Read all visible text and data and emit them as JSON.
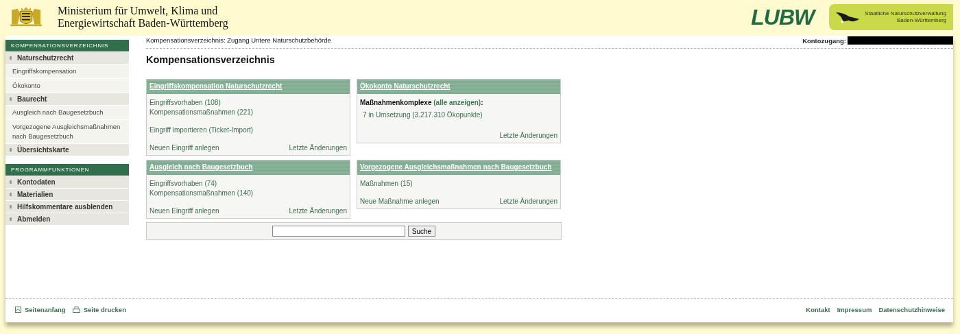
{
  "header": {
    "ministry_lines": [
      "Ministerium für Umwelt, Klima und",
      "Energiewirtschaft Baden-Württemberg"
    ],
    "logo_text": "LUBW",
    "badge_lines": [
      "Staatliche Naturschutzverwaltung",
      "Baden-Württemberg"
    ]
  },
  "sidebar": [
    {
      "title": "KOMPENSATIONSVERZEICHNIS",
      "items": [
        {
          "label": "Naturschutzrecht",
          "children": [
            {
              "label": "Eingriffskompensation"
            },
            {
              "label": "Ökokonto"
            }
          ]
        },
        {
          "label": "Baurecht",
          "children": [
            {
              "label": "Ausgleich nach Baugesetzbuch"
            },
            {
              "label": "Vorgezogene Ausgleichsmaßnahmen nach Baugesetzbuch"
            }
          ]
        },
        {
          "label": "Übersichtskarte"
        }
      ]
    },
    {
      "title": "PROGRAMMFUNKTIONEN",
      "items": [
        {
          "label": "Kontodaten"
        },
        {
          "label": "Materialien"
        },
        {
          "label": "Hilfskommentare ausblenden"
        },
        {
          "label": "Abmelden"
        }
      ]
    }
  ],
  "breadcrumb": "Kompensationsverzeichnis: Zugang Untere Naturschutzbehörde",
  "account_label": "Kontozugang:",
  "page_title": "Kompensationsverzeichnis",
  "boxes": [
    {
      "title": "Eingriffskompensation Naturschutzrecht",
      "groups": [
        [
          "Eingriffsvorhaben (108)",
          "Kompensationsmaßnahmen (221)"
        ],
        [
          "Eingriff importieren (Ticket-Import)"
        ]
      ],
      "footer_left": "Neuen Eingriff anlegen",
      "footer_right": "Letzte Änderungen"
    },
    {
      "title": "Ökokonto Naturschutzrecht",
      "heading": {
        "label": "Maßnahmenkomplexe",
        "link": "(alle anzeigen)",
        "suffix": ":"
      },
      "groups": [
        [
          "7 in Umsetzung (3.217.310 Ökopunkte)"
        ]
      ],
      "footer_right": "Letzte Änderungen"
    },
    {
      "title": "Ausgleich nach Baugesetzbuch",
      "groups": [
        [
          "Eingriffsvorhaben (74)",
          "Kompensationsmaßnahmen (140)"
        ]
      ],
      "footer_left": "Neuen Eingriff anlegen",
      "footer_right": "Letzte Änderungen"
    },
    {
      "title": "Vorgezogene Ausgleichsmaßnahmen nach Baugesetzbuch",
      "groups": [
        [
          "Maßnahmen (15)"
        ]
      ],
      "footer_left": "Neue Maßnahme anlegen",
      "footer_right": "Letzte Änderungen"
    }
  ],
  "search": {
    "button": "Suche"
  },
  "footer": {
    "left": [
      {
        "kind": "top",
        "label": "Seitenanfang"
      },
      {
        "kind": "print",
        "label": "Seite drucken"
      }
    ],
    "right": [
      "Kontakt",
      "Impressum",
      "Datenschutzhinweise"
    ]
  }
}
